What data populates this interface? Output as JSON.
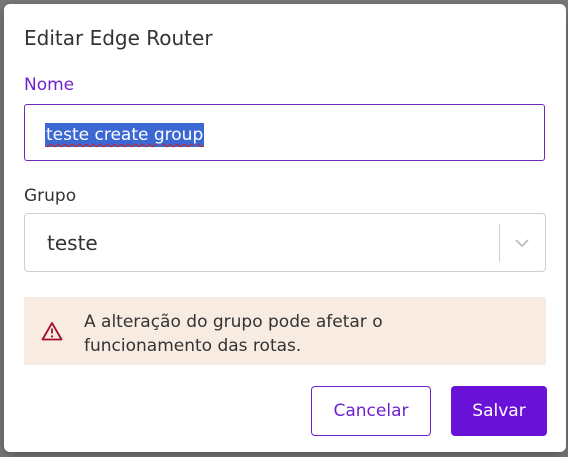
{
  "dialog": {
    "title": "Editar Edge Router",
    "name_label": "Nome",
    "name_value": "teste create group",
    "group_label": "Grupo",
    "group_value": "teste",
    "alert_message": "A alteração do grupo pode afetar o funcionamento das rotas.",
    "cancel_label": "Cancelar",
    "save_label": "Salvar"
  },
  "icons": {
    "alert": "warning-triangle-icon",
    "select": "chevron-down-icon"
  },
  "colors": {
    "accent": "#6a11d8",
    "alert_bg": "#f8ebe2",
    "warning": "#a0102a"
  }
}
